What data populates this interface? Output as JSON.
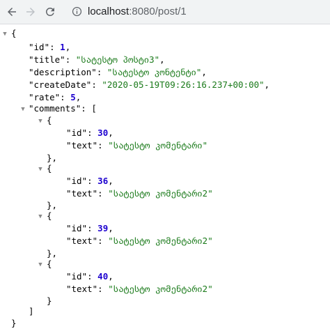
{
  "browser": {
    "url_host": "localhost",
    "url_path": ":8080/post/1"
  },
  "json": {
    "open_brace": "{",
    "close_brace": "}",
    "id_key": "\"id\"",
    "id_value": "1",
    "title_key": "\"title\"",
    "title_value": "\"სატესტო პოსტი3\"",
    "description_key": "\"description\"",
    "description_value": "\"სატესტო კონტენტი\"",
    "createDate_key": "\"createDate\"",
    "createDate_value": "\"2020-05-19T09:26:16.237+00:00\"",
    "rate_key": "\"rate\"",
    "rate_value": "5",
    "comments_key": "\"comments\"",
    "comments_open": "[",
    "comments_close": "]",
    "comments": [
      {
        "id_key": "\"id\"",
        "id": "30",
        "text_key": "\"text\"",
        "text": "\"სატესტო კომენტარი\""
      },
      {
        "id_key": "\"id\"",
        "id": "36",
        "text_key": "\"text\"",
        "text": "\"სატესტო კომენტარი2\""
      },
      {
        "id_key": "\"id\"",
        "id": "39",
        "text_key": "\"text\"",
        "text": "\"სატესტო კომენტარი2\""
      },
      {
        "id_key": "\"id\"",
        "id": "40",
        "text_key": "\"text\"",
        "text": "\"სატესტო კომენტარი2\""
      }
    ]
  }
}
